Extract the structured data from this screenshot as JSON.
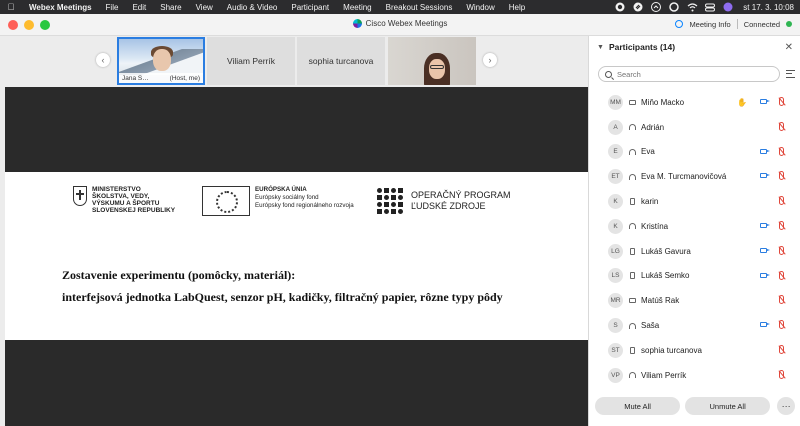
{
  "menubar": {
    "app": "Webex Meetings",
    "items": [
      "File",
      "Edit",
      "Share",
      "View",
      "Audio & Video",
      "Participant",
      "Meeting",
      "Breakout Sessions",
      "Window",
      "Help"
    ],
    "clock": "st 17. 3.  10:08"
  },
  "window": {
    "title": "Cisco Webex Meetings",
    "meeting_info": "Meeting Info",
    "status": "Connected"
  },
  "strip": {
    "self_name": "Jana S…",
    "self_role": "(Host, me)",
    "tiles": [
      "Viliam Perrík",
      "sophia turcanova"
    ]
  },
  "slide": {
    "ministry_lines": [
      "MINISTERSTVO",
      "ŠKOLSTVA, VEDY,",
      "VÝSKUMU A ŠPORTU",
      "SLOVENSKEJ REPUBLIKY"
    ],
    "eu_lines": [
      "EURÓPSKA ÚNIA",
      "Európsky sociálny fond",
      "Európsky fond regionálneho rozvoja"
    ],
    "op_lines": [
      "OPERAČNÝ PROGRAM",
      "ĽUDSKÉ ZDROJE"
    ],
    "line1": "Zostavenie experimentu (pomôcky, materiál):",
    "line2": "interfejsová jednotka LabQuest, senzor pH, kadičky, filtračný papier, rôzne typy pôdy"
  },
  "participants": {
    "header": "Participants (14)",
    "search_placeholder": "Search",
    "list": [
      {
        "initials": "MM",
        "name": "Miňo Macko",
        "device": "laptop",
        "hand": true,
        "video": true,
        "muted": true
      },
      {
        "initials": "A",
        "name": "Adrián",
        "device": "headset",
        "hand": false,
        "video": false,
        "muted": true
      },
      {
        "initials": "E",
        "name": "Eva",
        "device": "headset",
        "hand": false,
        "video": true,
        "muted": true
      },
      {
        "initials": "ET",
        "name": "Eva M. Turcmanovičová",
        "device": "headset",
        "hand": false,
        "video": true,
        "muted": true
      },
      {
        "initials": "K",
        "name": "karin",
        "device": "phone",
        "hand": false,
        "video": false,
        "muted": true
      },
      {
        "initials": "K",
        "name": "Kristína",
        "device": "headset",
        "hand": false,
        "video": true,
        "muted": true
      },
      {
        "initials": "LG",
        "name": "Lukáš Gavura",
        "device": "phone",
        "hand": false,
        "video": true,
        "muted": true
      },
      {
        "initials": "LS",
        "name": "Lukáš Semko",
        "device": "phone",
        "hand": false,
        "video": true,
        "muted": true
      },
      {
        "initials": "MR",
        "name": "Matúš Rak",
        "device": "laptop",
        "hand": false,
        "video": false,
        "muted": true
      },
      {
        "initials": "S",
        "name": "Saša",
        "device": "headset",
        "hand": false,
        "video": true,
        "muted": true
      },
      {
        "initials": "ST",
        "name": "sophia turcanova",
        "device": "phone",
        "hand": false,
        "video": false,
        "muted": true
      },
      {
        "initials": "VP",
        "name": "Viliam Perrík",
        "device": "headset",
        "hand": false,
        "video": false,
        "muted": true
      }
    ],
    "mute_all": "Mute All",
    "unmute_all": "Unmute All",
    "more": "···"
  }
}
